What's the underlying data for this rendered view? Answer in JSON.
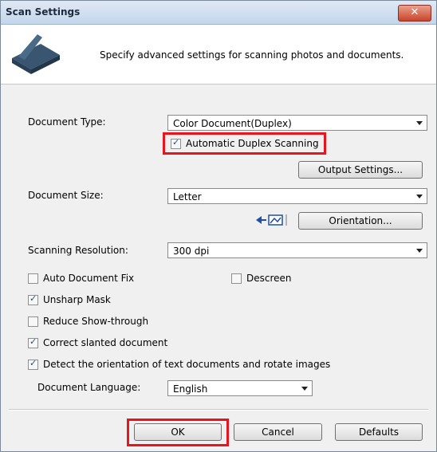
{
  "window": {
    "title": "Scan Settings",
    "close_label": "✕"
  },
  "header": {
    "description": "Specify advanced settings for scanning photos and documents."
  },
  "document_type": {
    "label": "Document Type:",
    "value": "Color Document(Duplex)"
  },
  "duplex": {
    "label": "Automatic Duplex Scanning",
    "checked": true
  },
  "output_settings_label": "Output Settings...",
  "document_size": {
    "label": "Document Size:",
    "value": "Letter"
  },
  "orientation_label": "Orientation...",
  "resolution": {
    "label": "Scanning Resolution:",
    "value": "300 dpi"
  },
  "options": {
    "auto_fix": {
      "label": "Auto Document Fix",
      "checked": false
    },
    "descreen": {
      "label": "Descreen",
      "checked": false
    },
    "unsharp": {
      "label": "Unsharp Mask",
      "checked": true
    },
    "reduce_show": {
      "label": "Reduce Show-through",
      "checked": false
    },
    "correct_slanted": {
      "label": "Correct slanted document",
      "checked": true
    },
    "detect_orientation": {
      "label": "Detect the orientation of text documents and rotate images",
      "checked": true
    }
  },
  "language": {
    "label": "Document Language:",
    "value": "English"
  },
  "buttons": {
    "ok": "OK",
    "cancel": "Cancel",
    "defaults": "Defaults"
  },
  "colors": {
    "highlight": "#e8141e"
  }
}
